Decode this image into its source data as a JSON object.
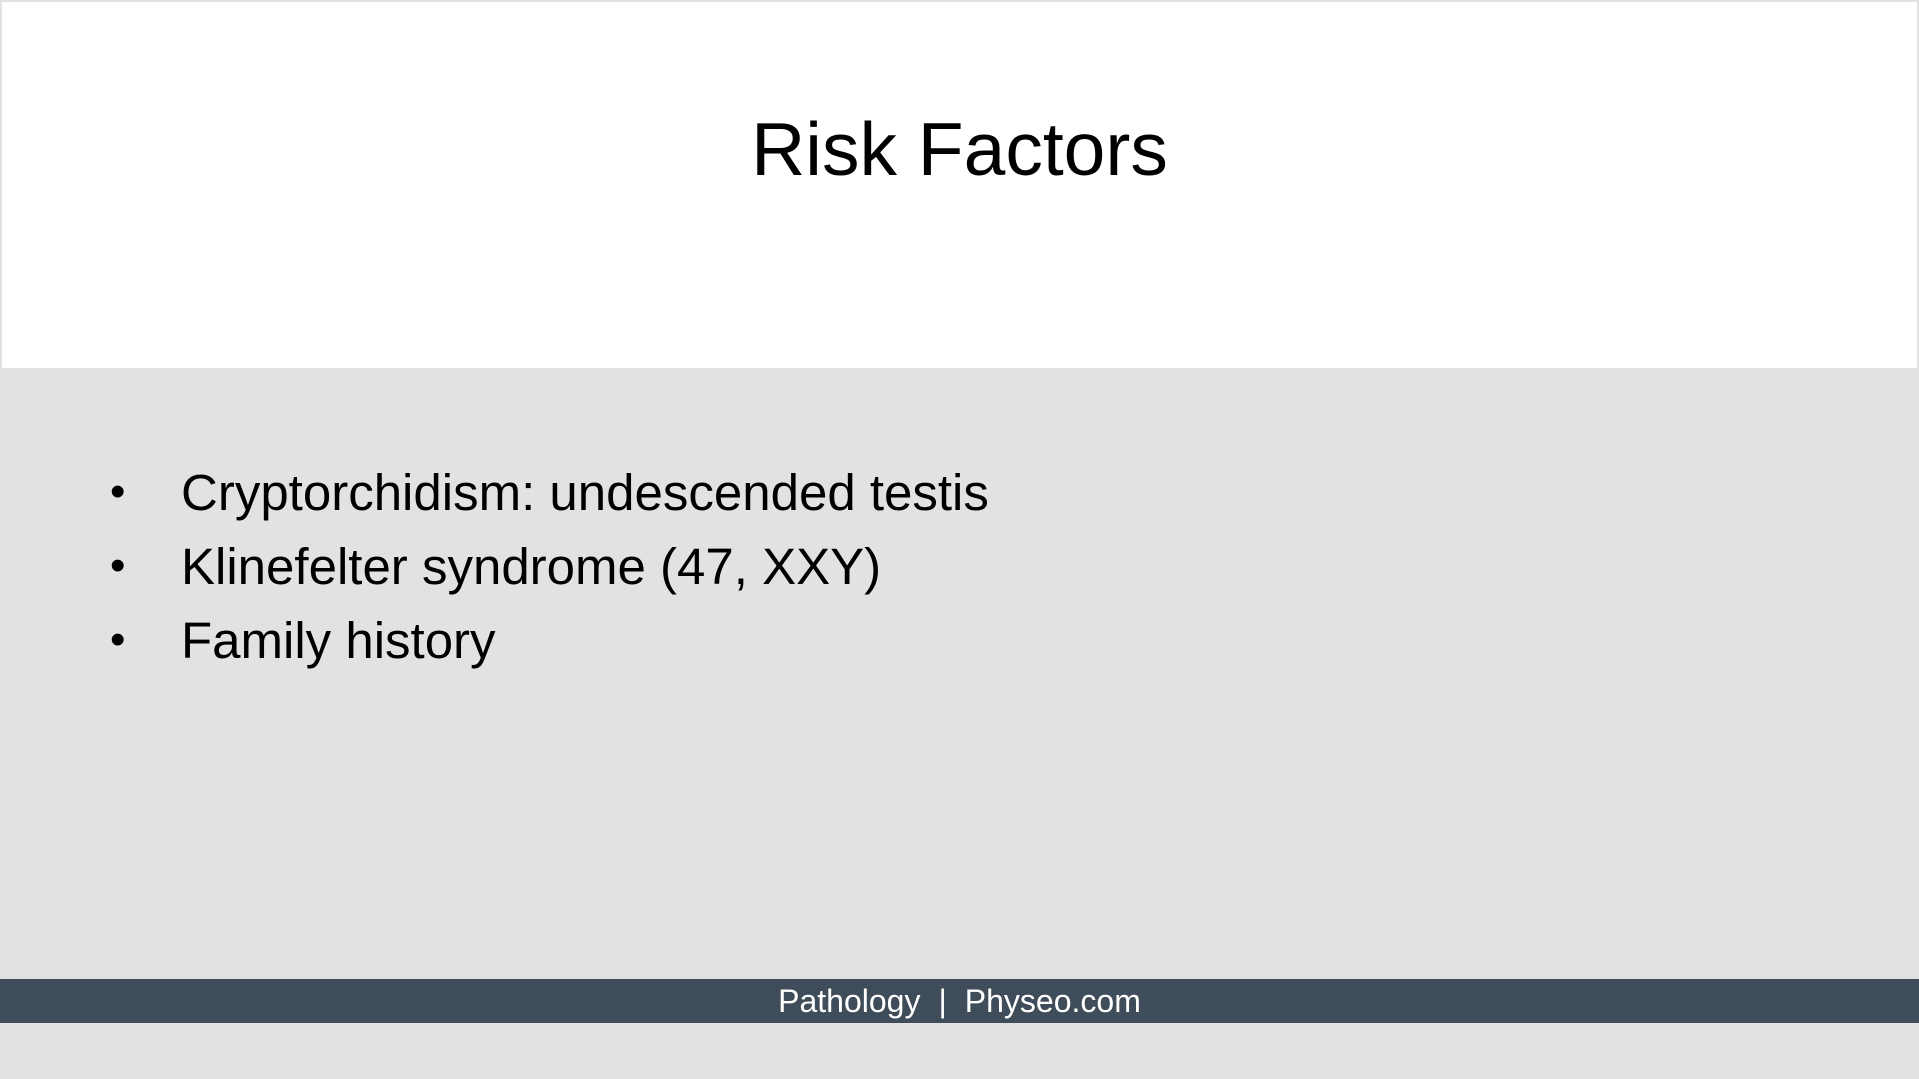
{
  "slide": {
    "title": "Risk Factors",
    "bullets": [
      "Cryptorchidism: undescended testis",
      "Klinefelter syndrome (47, XXY)",
      "Family history"
    ],
    "footer": {
      "left": "Pathology",
      "separator": "|",
      "right": "Physeo.com"
    }
  },
  "colors": {
    "background": "#e2e2e2",
    "title_box": "#ffffff",
    "footer_bar": "#3e4d59",
    "footer_text": "#ffffff"
  }
}
